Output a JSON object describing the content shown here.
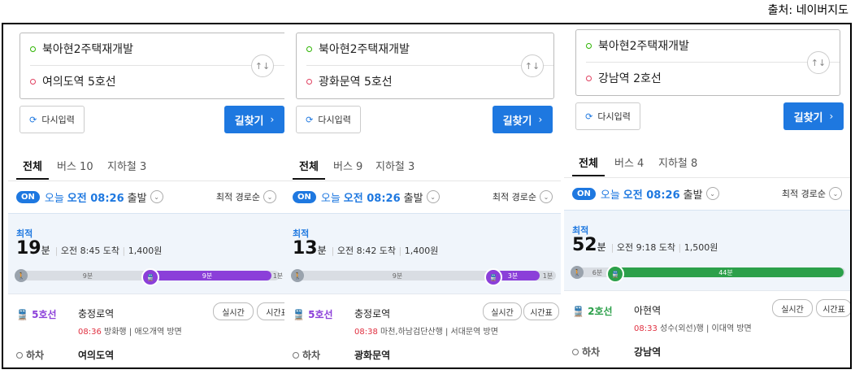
{
  "source": "출처: 네이버지도",
  "common": {
    "reset": "다시입력",
    "find": "길찾기",
    "tab_all": "전체",
    "on": "ON",
    "today": "오늘",
    "time": "오전 08:26",
    "depart": "출발",
    "sort": "최적 경로순",
    "best": "최적",
    "min_unit": "분",
    "realtime": "실시간",
    "timetable": "시간표",
    "alight": "하차"
  },
  "colors": {
    "blue": "#1e78e0",
    "line5": "#8b3fd9",
    "line2": "#2ca04a"
  },
  "panels": [
    {
      "from": "북아현2주택재개발",
      "to": "여의도역 5호선",
      "tab_bus": "버스 10",
      "tab_subway": "지하철 3",
      "minutes": "19",
      "arrive": "오전 8:45 도착",
      "fare": "1,400원",
      "walk1": "9분",
      "ride": "9분",
      "walk2": "1분",
      "line_name": "5호선",
      "board": "충정로역",
      "dep_time": "08:36",
      "dir": "방화행 | 애오개역 방면",
      "alight_station": "여의도역"
    },
    {
      "from": "북아현2주택재개발",
      "to": "광화문역 5호선",
      "tab_bus": "버스 9",
      "tab_subway": "지하철 3",
      "minutes": "13",
      "arrive": "오전 8:42 도착",
      "fare": "1,400원",
      "walk1": "9분",
      "ride": "3분",
      "walk2": "1분",
      "line_name": "5호선",
      "board": "충정로역",
      "dep_time": "08:38",
      "dir": "마천,하남검단산행 | 서대문역 방면",
      "alight_station": "광화문역"
    },
    {
      "from": "북아현2주택재개발",
      "to": "강남역 2호선",
      "tab_bus": "버스 4",
      "tab_subway": "지하철 8",
      "minutes": "52",
      "arrive": "오전 9:18 도착",
      "fare": "1,500원",
      "walk1": "6분",
      "ride": "44분",
      "walk2": "",
      "line_name": "2호선",
      "board": "아현역",
      "dep_time": "08:33",
      "dir": "성수(외선)행 | 이대역 방면",
      "alight_station": "강남역"
    }
  ]
}
